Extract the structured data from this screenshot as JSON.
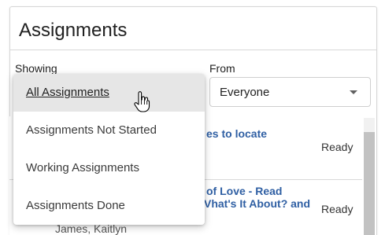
{
  "panel": {
    "title": "Assignments"
  },
  "filters": {
    "showing_label": "Showing",
    "from_label": "From",
    "from_value": "Everyone"
  },
  "menu": {
    "items": [
      {
        "label": "All Assignments",
        "active": true
      },
      {
        "label": "Assignments Not Started",
        "active": false
      },
      {
        "label": "Working Assignments",
        "active": false
      },
      {
        "label": "Assignments Done",
        "active": false
      }
    ]
  },
  "list": {
    "rows": [
      {
        "title_line1": "es to locate",
        "status": "Ready"
      },
      {
        "title_line1": "of Love - Read",
        "title_line2": "Vhat's It About? and",
        "status": "Ready",
        "sub": "James, Kaitlyn"
      }
    ]
  },
  "colors": {
    "link": "#2f5fa3",
    "menu_highlight": "#e6e6e6"
  },
  "icons": {
    "cursor": "hand-pointer-icon",
    "dropdown": "caret-down-icon"
  }
}
